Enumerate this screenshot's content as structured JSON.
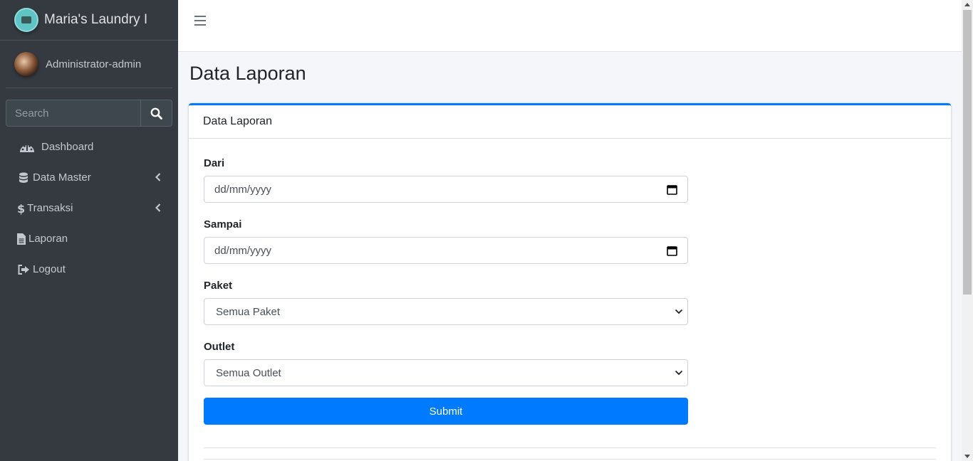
{
  "brand": {
    "name": "Maria's Laundry I"
  },
  "user": {
    "name": "Administrator-admin"
  },
  "search": {
    "placeholder": "Search"
  },
  "nav": {
    "items": [
      {
        "label": "Dashboard",
        "icon": "tachometer-icon"
      },
      {
        "label": "Data Master",
        "icon": "database-icon",
        "has_children": true
      },
      {
        "label": "Transaksi",
        "icon": "dollar-icon",
        "has_children": true
      },
      {
        "label": "Laporan",
        "icon": "file-icon"
      },
      {
        "label": "Logout",
        "icon": "sign-out-icon"
      }
    ]
  },
  "page": {
    "title": "Data Laporan"
  },
  "card": {
    "title": "Data Laporan",
    "fields": {
      "dari": {
        "label": "Dari",
        "value": "dd/mm/yyyy"
      },
      "sampai": {
        "label": "Sampai",
        "value": "dd/mm/yyyy"
      },
      "paket": {
        "label": "Paket",
        "selected": "Semua Paket"
      },
      "outlet": {
        "label": "Outlet",
        "selected": "Semua Outlet"
      }
    },
    "submit_label": "Submit"
  },
  "colors": {
    "sidebar": "#343a40",
    "primary": "#007bff",
    "background": "#f4f6f9"
  }
}
